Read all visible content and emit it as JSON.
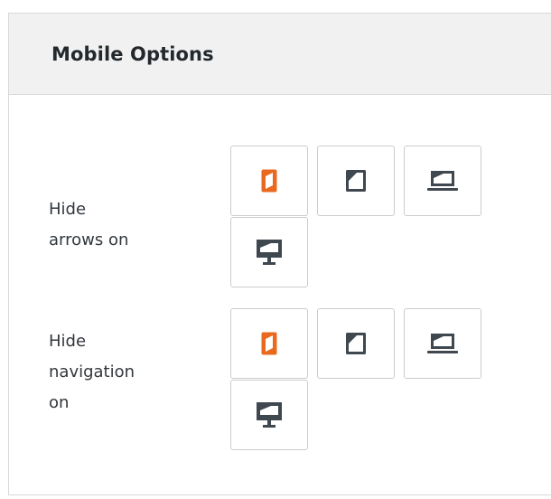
{
  "panel": {
    "title": "Mobile Options"
  },
  "rows": [
    {
      "label": "Hide arrows on",
      "label_lines": [
        "Hide",
        "arrows on"
      ],
      "devices": [
        {
          "name": "phone-icon",
          "active": true
        },
        {
          "name": "tablet-icon",
          "active": false
        },
        {
          "name": "laptop-icon",
          "active": false
        },
        {
          "name": "desktop-icon",
          "active": false
        }
      ]
    },
    {
      "label": "Hide navigation on",
      "label_lines": [
        "Hide",
        "navigation",
        "on"
      ],
      "devices": [
        {
          "name": "phone-icon",
          "active": true
        },
        {
          "name": "tablet-icon",
          "active": false
        },
        {
          "name": "laptop-icon",
          "active": false
        },
        {
          "name": "desktop-icon",
          "active": false
        }
      ]
    }
  ],
  "colors": {
    "active": "#e96a1f",
    "inactive": "#3f474f",
    "header_bg": "#f1f1f1",
    "border": "#cccccc"
  }
}
